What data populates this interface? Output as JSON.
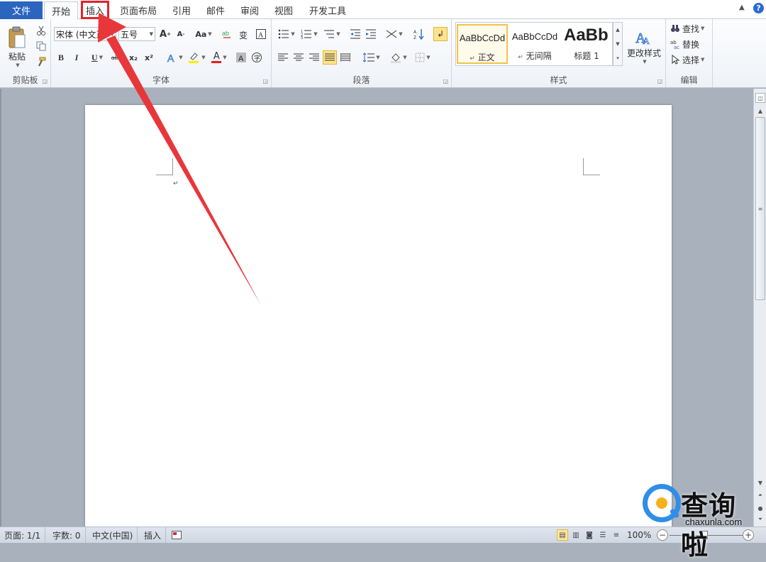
{
  "tabs": {
    "file": "文件",
    "home": "开始",
    "insert": "插入",
    "layout": "页面布局",
    "references": "引用",
    "mailings": "邮件",
    "review": "审阅",
    "view": "视图",
    "developer": "开发工具"
  },
  "ribbon": {
    "clipboard": {
      "label": "剪贴板",
      "paste": "粘贴"
    },
    "font": {
      "label": "字体",
      "font_name": "宋体 (中文正",
      "font_size": "五号",
      "grow": "A",
      "shrink": "A",
      "change_case": "Aa",
      "bold": "B",
      "italic": "I",
      "underline": "U",
      "strike": "abc",
      "subscript": "x₂",
      "superscript": "x²",
      "font_color": "A"
    },
    "paragraph": {
      "label": "段落"
    },
    "styles": {
      "label": "样式",
      "items": [
        {
          "sample": "AaBbCcDd",
          "name": "正文"
        },
        {
          "sample": "AaBbCcDd",
          "name": "无间隔"
        },
        {
          "sample": "AaBb",
          "name": "标题 1"
        }
      ],
      "change_styles": "更改样式"
    },
    "editing": {
      "label": "编辑",
      "find": "查找",
      "replace": "替换",
      "select": "选择"
    }
  },
  "document": {
    "paragraph_mark": "↵"
  },
  "status": {
    "page": "页面: 1/1",
    "words": "字数: 0",
    "language": "中文(中国)",
    "mode": "插入",
    "zoom": "100%",
    "zoom_level": 100
  },
  "watermark": {
    "text": "查询啦",
    "sub": "chaxunla.com"
  },
  "colors": {
    "file_tab": "#2b65c0",
    "highlight": "#e3232c",
    "arrow": "#e8373b"
  }
}
